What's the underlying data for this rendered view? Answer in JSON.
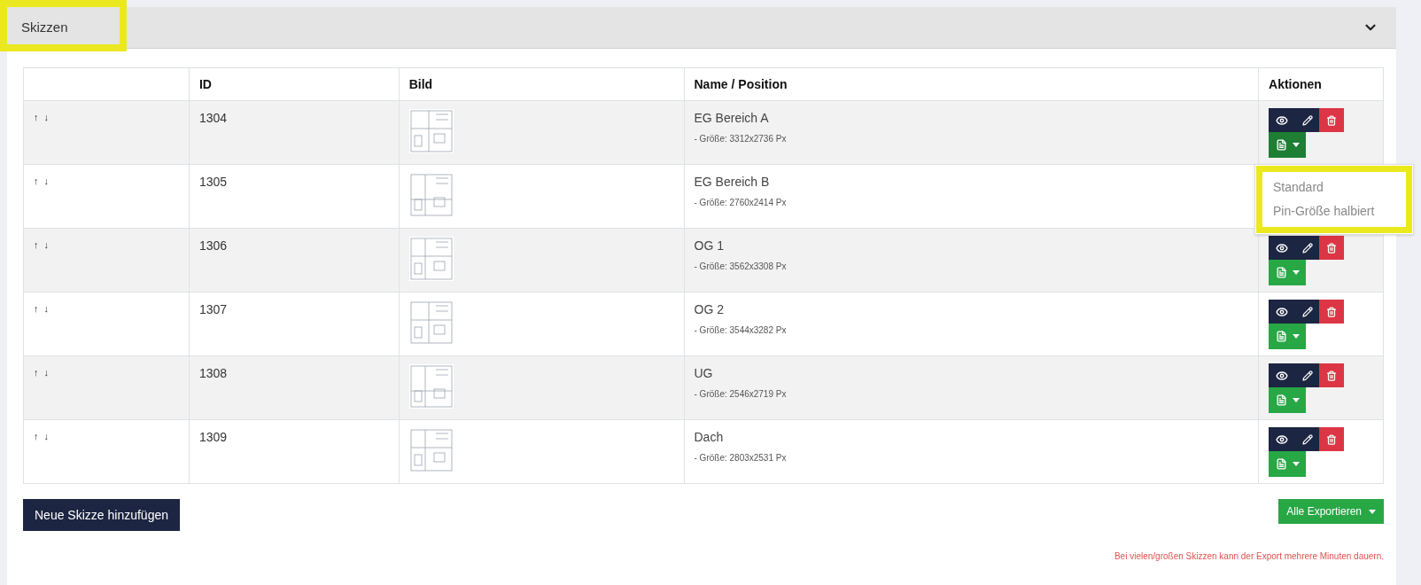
{
  "panel": {
    "title": "Skizzen",
    "title_highlighted": true,
    "expanded": true
  },
  "table": {
    "columns": [
      "ID",
      "Bild",
      "Name / Position",
      "Aktionen"
    ],
    "rows": [
      {
        "move_up": "↑",
        "move_down": "↓",
        "id": "1304",
        "name": "EG Bereich A",
        "size": "- Größe: 3312x2736 Px",
        "export_menu_open": true,
        "actions_covered": false
      },
      {
        "move_up": "↑",
        "move_down": "↓",
        "id": "1305",
        "name": "EG Bereich B",
        "size": "- Größe: 2760x2414 Px",
        "export_menu_open": false,
        "actions_covered": true
      },
      {
        "move_up": "↑",
        "move_down": "↓",
        "id": "1306",
        "name": "OG 1",
        "size": "- Größe: 3562x3308 Px",
        "export_menu_open": false,
        "actions_covered": false
      },
      {
        "move_up": "↑",
        "move_down": "↓",
        "id": "1307",
        "name": "OG 2",
        "size": "- Größe: 3544x3282 Px",
        "export_menu_open": false,
        "actions_covered": false
      },
      {
        "move_up": "↑",
        "move_down": "↓",
        "id": "1308",
        "name": "UG",
        "size": "- Größe: 2546x2719 Px",
        "export_menu_open": false,
        "actions_covered": false
      },
      {
        "move_up": "↑",
        "move_down": "↓",
        "id": "1309",
        "name": "Dach",
        "size": "- Größe: 2803x2531 Px",
        "export_menu_open": false,
        "actions_covered": false
      }
    ]
  },
  "export_menu": {
    "highlighted": true,
    "items": [
      {
        "label": "Standard"
      },
      {
        "label": "Pin-Größe halbiert"
      }
    ]
  },
  "add_button": "Neue Skizze hinzufügen",
  "export_all_button": "Alle Exportieren",
  "note": "Bei vielen/großen Skizzen kann der Export mehrere Minuten dauern."
}
